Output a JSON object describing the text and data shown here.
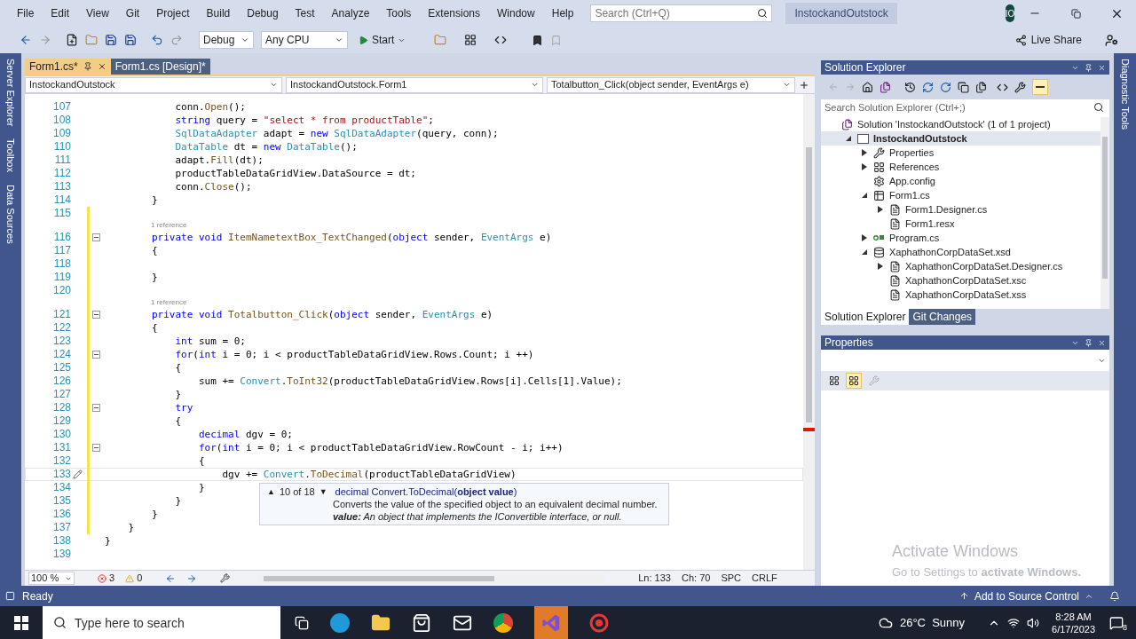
{
  "menu": [
    "File",
    "Edit",
    "View",
    "Git",
    "Project",
    "Build",
    "Debug",
    "Test",
    "Analyze",
    "Tools",
    "Extensions",
    "Window",
    "Help"
  ],
  "search": {
    "placeholder": "Search (Ctrl+Q)"
  },
  "solution_name": "InstockandOutstock",
  "avatar": "IO",
  "toolbar": {
    "configuration": "Debug",
    "platform": "Any CPU",
    "start": "Start",
    "live_share": "Live Share"
  },
  "left_strip": [
    "Server Explorer",
    "Toolbox",
    "Data Sources"
  ],
  "right_strip": [
    "Diagnostic Tools"
  ],
  "doc_tabs": [
    {
      "label": "Form1.cs*",
      "selected": true
    },
    {
      "label": "Form1.cs [Design]*",
      "selected": false
    }
  ],
  "nav_bar": [
    "InstockandOutstock",
    "InstockandOutstock.Form1",
    "Totalbutton_Click(object sender, EventArgs e)"
  ],
  "lines": [
    {
      "kind": "code",
      "n": "107",
      "fold": false,
      "changed": false,
      "current": false,
      "code": [
        {
          "kind": "plain",
          "t": "            conn."
        },
        {
          "kind": "method",
          "t": "Open"
        },
        {
          "kind": "plain",
          "t": "();"
        }
      ]
    },
    {
      "kind": "code",
      "n": "108",
      "fold": false,
      "changed": false,
      "current": false,
      "code": [
        {
          "kind": "keyword",
          "t": "            string"
        },
        {
          "kind": "plain",
          "t": " query = "
        },
        {
          "kind": "string",
          "t": "\"select * from productTable\""
        },
        {
          "kind": "plain",
          "t": ";"
        }
      ]
    },
    {
      "kind": "code",
      "n": "109",
      "fold": false,
      "changed": false,
      "current": false,
      "code": [
        {
          "kind": "type",
          "t": "            SqlDataAdapter"
        },
        {
          "kind": "plain",
          "t": " adapt = "
        },
        {
          "kind": "keyword",
          "t": "new "
        },
        {
          "kind": "type",
          "t": "SqlDataAdapter"
        },
        {
          "kind": "plain",
          "t": "(query, conn);"
        }
      ]
    },
    {
      "kind": "code",
      "n": "110",
      "fold": false,
      "changed": false,
      "current": false,
      "code": [
        {
          "kind": "type",
          "t": "            DataTable"
        },
        {
          "kind": "plain",
          "t": " dt = "
        },
        {
          "kind": "keyword",
          "t": "new "
        },
        {
          "kind": "type",
          "t": "DataTable"
        },
        {
          "kind": "plain",
          "t": "();"
        }
      ]
    },
    {
      "kind": "code",
      "n": "111",
      "fold": false,
      "changed": false,
      "current": false,
      "code": [
        {
          "kind": "plain",
          "t": "            adapt."
        },
        {
          "kind": "method",
          "t": "Fill"
        },
        {
          "kind": "plain",
          "t": "(dt);"
        }
      ]
    },
    {
      "kind": "code",
      "n": "112",
      "fold": false,
      "changed": false,
      "current": false,
      "code": [
        {
          "kind": "plain",
          "t": "            productTableDataGridView.DataSource = dt;"
        }
      ]
    },
    {
      "kind": "code",
      "n": "113",
      "fold": false,
      "changed": false,
      "current": false,
      "code": [
        {
          "kind": "plain",
          "t": "            conn."
        },
        {
          "kind": "method",
          "t": "Close"
        },
        {
          "kind": "plain",
          "t": "();"
        }
      ]
    },
    {
      "kind": "code",
      "n": "114",
      "fold": false,
      "changed": false,
      "current": false,
      "code": [
        {
          "kind": "plain",
          "t": "        }"
        }
      ]
    },
    {
      "kind": "code",
      "n": "115",
      "fold": false,
      "changed": true,
      "current": false
    },
    {
      "kind": "lens",
      "changed": true,
      "text": "1 reference"
    },
    {
      "kind": "code",
      "n": "116",
      "fold": true,
      "changed": true,
      "current": false,
      "code": [
        {
          "kind": "keyword",
          "t": "        private void "
        },
        {
          "kind": "method",
          "t": "ItemNametextBox_TextChanged"
        },
        {
          "kind": "plain",
          "t": "("
        },
        {
          "kind": "keyword",
          "t": "object"
        },
        {
          "kind": "plain",
          "t": " sender, "
        },
        {
          "kind": "type",
          "t": "EventArgs"
        },
        {
          "kind": "plain",
          "t": " e)"
        }
      ]
    },
    {
      "kind": "code",
      "n": "117",
      "fold": false,
      "changed": true,
      "current": false,
      "code": [
        {
          "kind": "plain",
          "t": "        {"
        }
      ]
    },
    {
      "kind": "code",
      "n": "118",
      "fold": false,
      "changed": true,
      "current": false
    },
    {
      "kind": "code",
      "n": "119",
      "fold": false,
      "changed": true,
      "current": false,
      "code": [
        {
          "kind": "plain",
          "t": "        }"
        }
      ]
    },
    {
      "kind": "code",
      "n": "120",
      "fold": false,
      "changed": true,
      "current": false
    },
    {
      "kind": "lens",
      "changed": true,
      "text": "1 reference"
    },
    {
      "kind": "code",
      "n": "121",
      "fold": true,
      "changed": true,
      "current": false,
      "code": [
        {
          "kind": "keyword",
          "t": "        private void "
        },
        {
          "kind": "method",
          "t": "Totalbutton_Click"
        },
        {
          "kind": "plain",
          "t": "("
        },
        {
          "kind": "keyword",
          "t": "object"
        },
        {
          "kind": "plain",
          "t": " sender, "
        },
        {
          "kind": "type",
          "t": "EventArgs"
        },
        {
          "kind": "plain",
          "t": " e)"
        }
      ]
    },
    {
      "kind": "code",
      "n": "122",
      "fold": false,
      "changed": true,
      "current": false,
      "code": [
        {
          "kind": "plain",
          "t": "        {"
        }
      ]
    },
    {
      "kind": "code",
      "n": "123",
      "fold": false,
      "changed": true,
      "current": false,
      "code": [
        {
          "kind": "keyword",
          "t": "            int"
        },
        {
          "kind": "plain",
          "t": " sum = 0;"
        }
      ]
    },
    {
      "kind": "code",
      "n": "124",
      "fold": true,
      "changed": true,
      "current": false,
      "code": [
        {
          "kind": "keyword",
          "t": "            for"
        },
        {
          "kind": "plain",
          "t": "("
        },
        {
          "kind": "keyword",
          "t": "int"
        },
        {
          "kind": "plain",
          "t": " i = 0; i < productTableDataGridView.Rows.Count; i ++)"
        }
      ]
    },
    {
      "kind": "code",
      "n": "125",
      "fold": false,
      "changed": true,
      "current": false,
      "code": [
        {
          "kind": "plain",
          "t": "            {"
        }
      ]
    },
    {
      "kind": "code",
      "n": "126",
      "fold": false,
      "changed": true,
      "current": false,
      "code": [
        {
          "kind": "plain",
          "t": "                sum += "
        },
        {
          "kind": "type",
          "t": "Convert"
        },
        {
          "kind": "plain",
          "t": "."
        },
        {
          "kind": "method",
          "t": "ToInt32"
        },
        {
          "kind": "plain",
          "t": "(productTableDataGridView.Rows[i].Cells[1].Value);"
        }
      ]
    },
    {
      "kind": "code",
      "n": "127",
      "fold": false,
      "changed": true,
      "current": false,
      "code": [
        {
          "kind": "plain",
          "t": "            }"
        }
      ]
    },
    {
      "kind": "code",
      "n": "128",
      "fold": true,
      "changed": true,
      "current": false,
      "code": [
        {
          "kind": "keyword",
          "t": "            try"
        }
      ]
    },
    {
      "kind": "code",
      "n": "129",
      "fold": false,
      "changed": true,
      "current": false,
      "code": [
        {
          "kind": "plain",
          "t": "            {"
        }
      ]
    },
    {
      "kind": "code",
      "n": "130",
      "fold": false,
      "changed": true,
      "current": false,
      "code": [
        {
          "kind": "keyword",
          "t": "                decimal"
        },
        {
          "kind": "plain",
          "t": " dgv = 0;"
        }
      ]
    },
    {
      "kind": "code",
      "n": "131",
      "fold": true,
      "changed": true,
      "current": false,
      "code": [
        {
          "kind": "keyword",
          "t": "                for"
        },
        {
          "kind": "plain",
          "t": "("
        },
        {
          "kind": "keyword",
          "t": "int"
        },
        {
          "kind": "plain",
          "t": " i = 0; i < productTableDataGridView.RowCount - i; i++)"
        }
      ]
    },
    {
      "kind": "code",
      "n": "132",
      "fold": false,
      "changed": true,
      "current": false,
      "code": [
        {
          "kind": "plain",
          "t": "                {"
        }
      ]
    },
    {
      "kind": "code",
      "n": "133",
      "fold": false,
      "changed": true,
      "current": true,
      "code": [
        {
          "kind": "plain",
          "t": "                    dgv += "
        },
        {
          "kind": "type",
          "t": "Convert"
        },
        {
          "kind": "plain",
          "t": "."
        },
        {
          "kind": "method",
          "t": "ToDecimal"
        },
        {
          "kind": "plain",
          "t": "(productTableDataGridView)"
        }
      ]
    },
    {
      "kind": "code",
      "n": "134",
      "fold": false,
      "changed": true,
      "current": false,
      "code": [
        {
          "kind": "plain",
          "t": "                }"
        }
      ]
    },
    {
      "kind": "code",
      "n": "135",
      "fold": false,
      "changed": true,
      "current": false,
      "code": [
        {
          "kind": "plain",
          "t": "            }"
        }
      ]
    },
    {
      "kind": "code",
      "n": "136",
      "fold": false,
      "changed": true,
      "current": false,
      "code": [
        {
          "kind": "plain",
          "t": "        }"
        }
      ]
    },
    {
      "kind": "code",
      "n": "137",
      "fold": false,
      "changed": true,
      "current": false,
      "code": [
        {
          "kind": "plain",
          "t": "    }"
        }
      ]
    },
    {
      "kind": "code",
      "n": "138",
      "fold": false,
      "changed": false,
      "current": false,
      "code": [
        {
          "kind": "plain",
          "t": "}"
        }
      ]
    },
    {
      "kind": "code",
      "n": "139",
      "fold": false,
      "changed": false,
      "current": false
    }
  ],
  "tooltip": {
    "up": "▲",
    "counter": "10 of 18",
    "down": "▼",
    "signature": "decimal Convert.ToDecimal(**object value**)",
    "description": "Converts the value of the specified object to an equivalent decimal number.",
    "param": "**value:** An object that implements the IConvertible interface, or null."
  },
  "editor_status": {
    "zoom": "100 %",
    "errors": "3",
    "warnings": "0",
    "line": "Ln: 133",
    "column": "Ch: 70",
    "whitespace": "SPC",
    "line_ending": "CRLF"
  },
  "solution_explorer": {
    "title": "Solution Explorer",
    "preview_on": true,
    "search": {
      "placeholder": "Search Solution Explorer (Ctrl+;)"
    },
    "tree": [
      {
        "kind": "solution",
        "label": "Solution 'InstockandOutstock' (1 of 1 project)",
        "selected": false,
        "children": [
          {
            "kind": "project",
            "label": "InstockandOutstock",
            "selected": true,
            "expanded": true,
            "children": [
              {
                "kind": "properties",
                "label": "Properties",
                "selected": false,
                "expanded": false
              },
              {
                "kind": "references",
                "label": "References",
                "selected": false,
                "expanded": false
              },
              {
                "kind": "config",
                "label": "App.config",
                "selected": false
              },
              {
                "kind": "form",
                "label": "Form1.cs",
                "selected": false,
                "expanded": true,
                "children": [
                  {
                    "kind": "file",
                    "label": "Form1.Designer.cs",
                    "selected": false,
                    "expanded": false
                  },
                  {
                    "kind": "file",
                    "label": "Form1.resx",
                    "selected": false
                  }
                ]
              },
              {
                "kind": "csharp",
                "label": "Program.cs",
                "selected": false,
                "expanded": false
              },
              {
                "kind": "dataset",
                "label": "XaphathonCorpDataSet.xsd",
                "selected": false,
                "expanded": true,
                "children": [
                  {
                    "kind": "file",
                    "label": "XaphathonCorpDataSet.Designer.cs",
                    "selected": false,
                    "expanded": false
                  },
                  {
                    "kind": "file",
                    "label": "XaphathonCorpDataSet.xsc",
                    "selected": false
                  },
                  {
                    "kind": "file",
                    "label": "XaphathonCorpDataSet.xss",
                    "selected": false
                  }
                ]
              }
            ]
          }
        ]
      }
    ],
    "tabs": [
      {
        "label": "Solution Explorer",
        "selected": true
      },
      {
        "label": "Git Changes",
        "selected": false
      }
    ]
  },
  "properties": {
    "title": "Properties",
    "sort_buttons": [
      {
        "selected": false
      },
      {
        "selected": true
      }
    ]
  },
  "activation": {
    "title": "Activate Windows",
    "body": "Go to Settings to **activate Windows.**"
  },
  "status_bar": {
    "state": "Ready",
    "source_control": "Add to Source Control"
  },
  "taskbar": {
    "search": {
      "placeholder": "Type here to search"
    },
    "weather": "26°C  Sunny",
    "time": "8:28 AM",
    "date": "6/17/2023",
    "notifications": "8"
  }
}
